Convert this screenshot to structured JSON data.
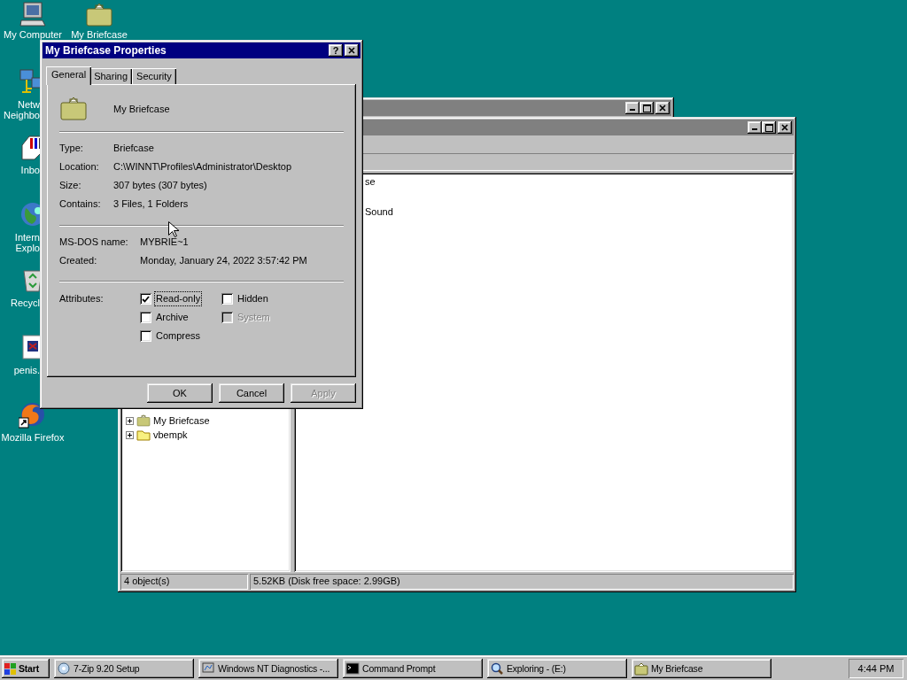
{
  "desktop_icons": [
    {
      "kind": "computer",
      "shortcut": false,
      "lines": [
        "My Computer"
      ]
    },
    {
      "kind": "briefcase",
      "shortcut": false,
      "lines": [
        "My Briefcase"
      ]
    },
    {
      "kind": "network",
      "shortcut": false,
      "lines": [
        "Netw",
        "Neighbo"
      ]
    },
    {
      "kind": "inbox",
      "shortcut": false,
      "lines": [
        "Inbo"
      ]
    },
    {
      "kind": "globe",
      "shortcut": false,
      "lines": [
        "Intern",
        "Explo"
      ]
    },
    {
      "kind": "recycle",
      "shortcut": false,
      "lines": [
        "Recycl"
      ]
    },
    {
      "kind": "document",
      "shortcut": false,
      "lines": [
        "penis."
      ]
    },
    {
      "kind": "firefox",
      "shortcut": true,
      "lines": [
        "Mozilla Firefox"
      ]
    }
  ],
  "explorer": {
    "tree": [
      {
        "label": "My Briefcase",
        "kind": "briefcase",
        "expanded": false
      },
      {
        "label": "vbempk",
        "kind": "folder",
        "expanded": false
      }
    ],
    "files": [
      "se",
      "Sound"
    ],
    "status_bar": [
      "4 object(s)",
      "5.52KB (Disk free space: 2.99GB)"
    ]
  },
  "dialog": {
    "title": "My Briefcase Properties",
    "help_button": "?",
    "tabs": [
      {
        "label": "General",
        "selected": true
      },
      {
        "label": "Sharing",
        "selected": false
      },
      {
        "label": "Security",
        "selected": false
      }
    ],
    "name": "My Briefcase",
    "info": [
      {
        "label": "Type:",
        "value": "Briefcase"
      },
      {
        "label": "Location:",
        "value": "C:\\WINNT\\Profiles\\Administrator\\Desktop"
      },
      {
        "label": "Size:",
        "value": "307 bytes (307 bytes)"
      },
      {
        "label": "Contains:",
        "value": "3 Files, 1 Folders"
      }
    ],
    "dos_info": [
      {
        "label": "MS-DOS name:",
        "value": "MYBRIE~1"
      },
      {
        "label": "Created:",
        "value": "Monday, January 24, 2022 3:57:42 PM"
      }
    ],
    "attributes_label": "Attributes:",
    "attributes": [
      {
        "label": "Read-only",
        "checked": true,
        "disabled": false,
        "focused": true
      },
      {
        "label": "Hidden",
        "checked": false,
        "disabled": false,
        "focused": false
      },
      {
        "label": "Archive",
        "checked": false,
        "disabled": false,
        "focused": false
      },
      {
        "label": "System",
        "checked": false,
        "disabled": true,
        "focused": false
      },
      {
        "label": "Compress",
        "checked": false,
        "disabled": false,
        "focused": false
      }
    ],
    "buttons": [
      {
        "label": "OK",
        "disabled": false
      },
      {
        "label": "Cancel",
        "disabled": false
      },
      {
        "label": "Apply",
        "disabled": true
      }
    ]
  },
  "taskbar": {
    "start": "Start",
    "tasks": [
      {
        "label": "7-Zip 9.20 Setup",
        "kind": "setup",
        "selected": false
      },
      {
        "label": "Windows NT Diagnostics -...",
        "kind": "diagnostics",
        "selected": false
      },
      {
        "label": "Command Prompt",
        "kind": "console",
        "selected": false
      },
      {
        "label": "Exploring -  (E:)",
        "kind": "explorer",
        "selected": false
      },
      {
        "label": "My Briefcase",
        "kind": "briefcase",
        "selected": false
      }
    ],
    "clock": "4:44 PM"
  }
}
